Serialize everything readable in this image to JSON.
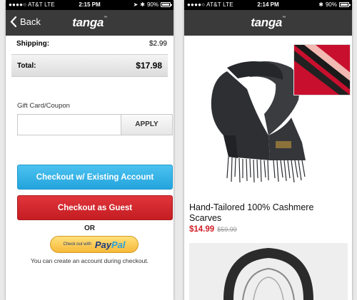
{
  "left_screen": {
    "status": {
      "carrier": "●●●●○ AT&T  LTE",
      "time": "2:15 PM",
      "battery": "90%"
    },
    "nav": {
      "back_label": "Back",
      "logo": "tanga"
    },
    "shipping": {
      "label": "Shipping:",
      "value": "$2.99"
    },
    "total": {
      "label": "Total:",
      "value": "$17.98"
    },
    "coupon": {
      "label": "Gift Card/Coupon",
      "placeholder": "",
      "apply_label": "APPLY"
    },
    "checkout_existing_label": "Checkout w/ Existing Account",
    "checkout_guest_label": "Checkout as Guest",
    "or_label": "OR",
    "paypal": {
      "small_text": "Check out with",
      "brand_part1": "Pay",
      "brand_part2": "Pal"
    },
    "account_note": "You can create an account during checkout."
  },
  "right_screen": {
    "status": {
      "carrier": "●●●●○ AT&T  LTE",
      "time": "2:14 PM",
      "battery": "90%"
    },
    "nav": {
      "logo": "tanga"
    },
    "product": {
      "title": "Hand-Tailored 100% Cashmere Scarves",
      "price": "$14.99",
      "original_price": "$59.99"
    }
  },
  "colors": {
    "navbar": "#3a3a3a",
    "checkout_existing": "#2fb0e4",
    "checkout_guest": "#d0272d",
    "paypal_yellow": "#f8c24a",
    "price_red": "#d12027"
  }
}
